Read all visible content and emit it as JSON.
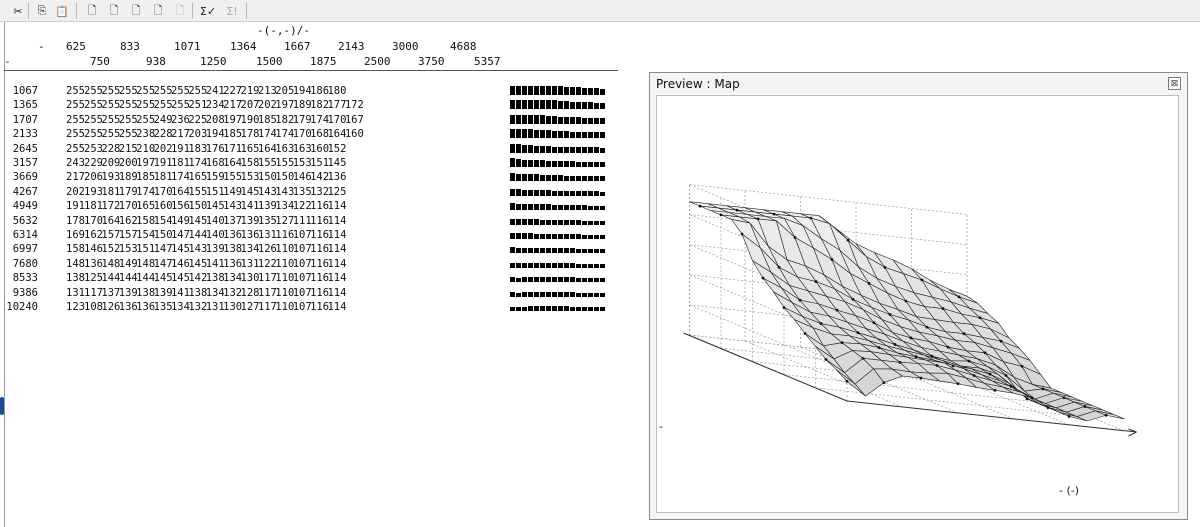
{
  "toolbar": {
    "buttons": [
      {
        "icon": "cut-icon",
        "glyph": "✂",
        "enabled": true
      },
      {
        "icon": "copy-icon",
        "glyph": "⎘",
        "enabled": true
      },
      {
        "icon": "paste-icon",
        "glyph": "📋",
        "enabled": true
      },
      {
        "icon": "page-add-icon",
        "glyph": "🗋",
        "enabled": true
      },
      {
        "icon": "page-remove-icon",
        "glyph": "🗋",
        "enabled": true
      },
      {
        "icon": "page-multiply-icon",
        "glyph": "🗋",
        "enabled": true
      },
      {
        "icon": "page-percent-icon",
        "glyph": "🗋",
        "enabled": true
      },
      {
        "icon": "page-disabled-icon",
        "glyph": "🗋",
        "enabled": false
      },
      {
        "icon": "sum-check-icon",
        "glyph": "Σ✓",
        "enabled": true
      },
      {
        "icon": "sum-icon",
        "glyph": "Σ!",
        "enabled": false
      }
    ]
  },
  "map_table": {
    "unit_label": "-(-,-)/-",
    "corner_dash_top": "-",
    "corner_dash_bottom": "-",
    "col_headers_row1": [
      "625",
      "833",
      "1071",
      "1364",
      "1667",
      "2143",
      "3000",
      "4688"
    ],
    "col_headers_row2": [
      "750",
      "938",
      "1250",
      "1500",
      "1875",
      "2500",
      "3750",
      "5357"
    ],
    "row_labels": [
      "1067",
      "1365",
      "1707",
      "2133",
      "2645",
      "3157",
      "3669",
      "4267",
      "4949",
      "5632",
      "6314",
      "6997",
      "7680",
      "8533",
      "9386",
      "10240"
    ],
    "rows": [
      [
        255,
        255,
        255,
        255,
        255,
        255,
        255,
        255,
        241,
        227,
        219,
        213,
        205,
        194,
        186,
        180
      ],
      [
        255,
        255,
        255,
        255,
        255,
        255,
        255,
        251,
        234,
        217,
        207,
        202,
        197,
        189,
        182,
        177,
        172
      ],
      [
        255,
        255,
        255,
        255,
        255,
        249,
        236,
        225,
        208,
        197,
        190,
        185,
        182,
        179,
        174,
        170,
        167
      ],
      [
        255,
        255,
        255,
        255,
        238,
        228,
        217,
        203,
        194,
        185,
        178,
        174,
        174,
        170,
        168,
        164,
        160
      ],
      [
        255,
        253,
        228,
        215,
        210,
        202,
        191,
        183,
        176,
        171,
        165,
        164,
        163,
        163,
        160,
        152
      ],
      [
        243,
        229,
        209,
        200,
        197,
        191,
        181,
        174,
        168,
        164,
        158,
        155,
        155,
        153,
        151,
        145
      ],
      [
        217,
        206,
        193,
        189,
        185,
        181,
        174,
        165,
        159,
        155,
        153,
        150,
        150,
        146,
        142,
        136
      ],
      [
        202,
        193,
        181,
        179,
        174,
        170,
        164,
        155,
        151,
        149,
        145,
        143,
        143,
        135,
        132,
        125
      ],
      [
        191,
        181,
        172,
        170,
        165,
        160,
        156,
        150,
        145,
        143,
        141,
        139,
        134,
        122,
        116,
        114
      ],
      [
        178,
        170,
        164,
        162,
        158,
        154,
        149,
        145,
        140,
        137,
        139,
        135,
        127,
        111,
        116,
        114
      ],
      [
        169,
        162,
        157,
        157,
        154,
        150,
        147,
        144,
        140,
        136,
        136,
        131,
        116,
        107,
        116,
        114
      ],
      [
        158,
        146,
        152,
        153,
        151,
        147,
        145,
        143,
        139,
        138,
        134,
        126,
        110,
        107,
        116,
        114
      ],
      [
        148,
        136,
        148,
        149,
        148,
        147,
        146,
        145,
        141,
        136,
        131,
        122,
        110,
        107,
        116,
        114
      ],
      [
        138,
        125,
        144,
        144,
        144,
        145,
        145,
        142,
        138,
        134,
        130,
        117,
        110,
        107,
        116,
        114
      ],
      [
        131,
        117,
        137,
        139,
        138,
        139,
        141,
        138,
        134,
        132,
        128,
        117,
        110,
        107,
        116,
        114
      ],
      [
        123,
        108,
        126,
        136,
        136,
        135,
        134,
        132,
        131,
        130,
        127,
        117,
        110,
        107,
        116,
        114
      ]
    ]
  },
  "preview": {
    "title": "Preview : Map",
    "close_glyph": "⊠",
    "axis_x_label": "- (-)",
    "axis_y_label": "-"
  }
}
